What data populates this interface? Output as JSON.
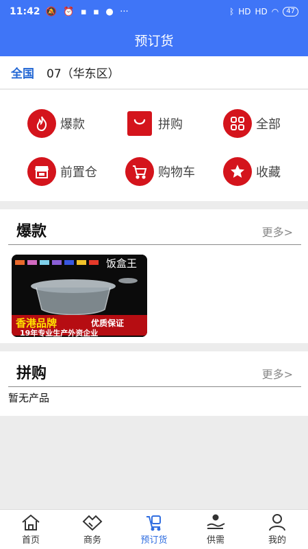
{
  "status": {
    "time": "11:42",
    "battery": "47",
    "signal1": "HD",
    "signal2": "HD"
  },
  "header": {
    "title": "预订货"
  },
  "region": {
    "country": "全国",
    "area": "07（华东区）"
  },
  "menu": [
    {
      "label": "爆款",
      "icon": "fire-icon"
    },
    {
      "label": "拼购",
      "icon": "shopping-bag-icon"
    },
    {
      "label": "全部",
      "icon": "grid-icon"
    },
    {
      "label": "前置仓",
      "icon": "store-icon"
    },
    {
      "label": "购物车",
      "icon": "cart-icon"
    },
    {
      "label": "收藏",
      "icon": "star-icon"
    }
  ],
  "hot": {
    "title": "爆款",
    "more": "更多>",
    "product": {
      "brand": "饭盒王",
      "slogan": "香港品牌",
      "tagline": "优质保证",
      "subline": "19年专业生产外资企业"
    }
  },
  "group": {
    "title": "拼购",
    "more": "更多>",
    "empty": "暂无产品"
  },
  "tabs": [
    {
      "label": "首页",
      "icon": "home-icon"
    },
    {
      "label": "商务",
      "icon": "handshake-icon"
    },
    {
      "label": "预订货",
      "icon": "preorder-icon"
    },
    {
      "label": "供需",
      "icon": "supply-icon"
    },
    {
      "label": "我的",
      "icon": "user-icon"
    }
  ],
  "colors": {
    "primary": "#3f75f7",
    "accent": "#d4141c",
    "active_tab": "#2f6de0",
    "region_label": "#2367d4"
  }
}
